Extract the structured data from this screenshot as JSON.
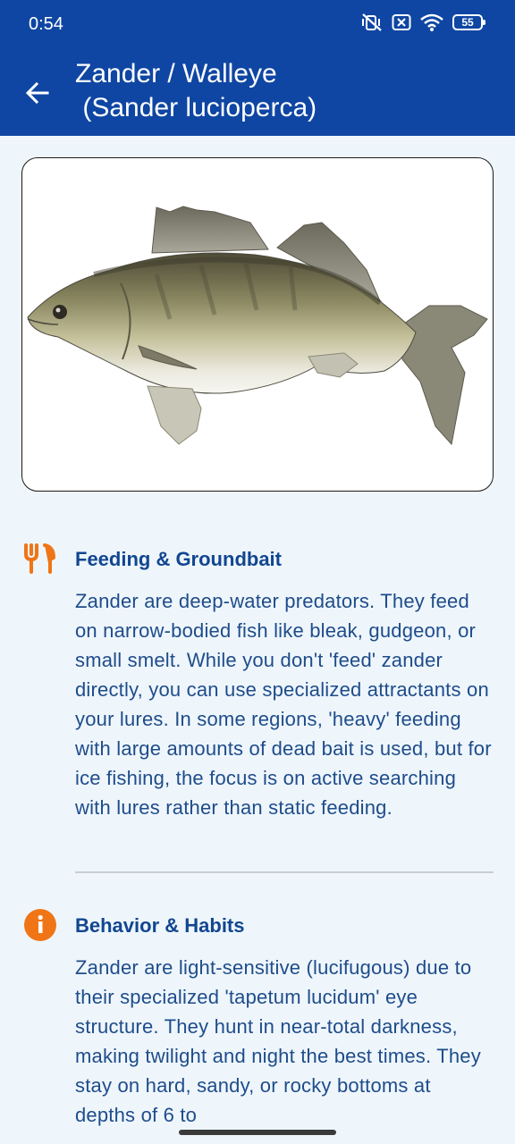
{
  "status_bar": {
    "time": "0:54",
    "battery_level": "55",
    "icons": [
      "vibrate-off-icon",
      "close-box-icon",
      "wifi-icon",
      "battery-icon"
    ]
  },
  "app_bar": {
    "title_line1": "Zander / Walleye",
    "title_line2": " (Sander lucioperca)",
    "back_icon": "arrow-back-icon"
  },
  "image": {
    "subject": "fish-photo",
    "border_color": "#1a1a1a"
  },
  "sections": [
    {
      "icon": "fork-knife-icon",
      "title": "Feeding & Groundbait",
      "body": "Zander are deep-water predators. They feed on narrow-bodied fish like bleak, gudgeon, or small smelt. While you don't 'feed' zander directly, you can use specialized attractants on your lures. In some regions, 'heavy' feeding with large amounts of dead bait is used, but for ice fishing, the focus is on active searching with lures rather than static feeding."
    },
    {
      "icon": "info-icon",
      "title": "Behavior & Habits",
      "body": "Zander are light-sensitive (lucifugous) due to their specialized 'tapetum lucidum' eye structure. They hunt in near-total darkness, making twilight and night the best times. They stay on hard, sandy, or rocky bottoms at depths of 6 to"
    }
  ],
  "colors": {
    "primary": "#0f46a3",
    "accent_orange": "#f07516",
    "background": "#eef6fc",
    "heading_text": "#12468f",
    "body_text": "#1f4c8a"
  }
}
